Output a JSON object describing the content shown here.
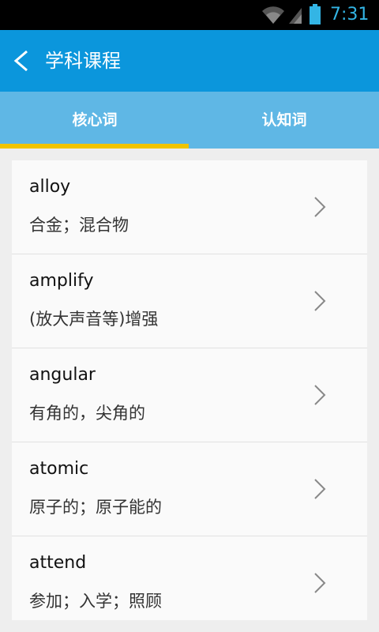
{
  "status": {
    "time": "7:31"
  },
  "header": {
    "title": "学科课程",
    "back_icon": "chevron-left-icon"
  },
  "tabs": [
    {
      "label": "核心词",
      "selected": true
    },
    {
      "label": "认知词",
      "selected": false
    }
  ],
  "colors": {
    "header": "#0b96dc",
    "tabs_bg": "#5fb7e5",
    "indicator": "#f0c400"
  },
  "words": [
    {
      "word": "alloy",
      "meaning": "合金；混合物"
    },
    {
      "word": "amplify",
      "meaning": "(放大声音等)增强"
    },
    {
      "word": "angular",
      "meaning": "有角的，尖角的"
    },
    {
      "word": "atomic",
      "meaning": "原子的；原子能的"
    },
    {
      "word": "attend",
      "meaning": "参加；入学；照顾"
    }
  ]
}
